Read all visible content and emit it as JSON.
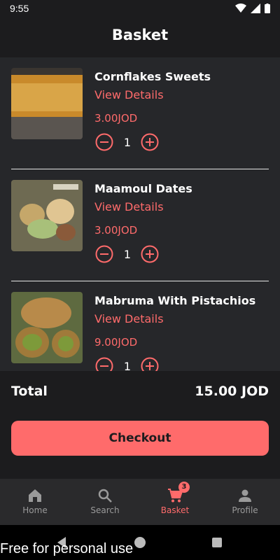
{
  "status": {
    "time": "9:55"
  },
  "header": {
    "title": "Basket"
  },
  "items": [
    {
      "name": "Cornflakes Sweets",
      "link": "View Details",
      "price": "3.00JOD",
      "qty": "1"
    },
    {
      "name": "Maamoul Dates",
      "link": "View Details",
      "price": "3.00JOD",
      "qty": "1"
    },
    {
      "name": "Mabruma With Pistachios",
      "link": "View Details",
      "price": "9.00JOD",
      "qty": "1"
    }
  ],
  "summary": {
    "total_label": "Total",
    "total_value": "15.00 JOD"
  },
  "checkout": {
    "label": "Checkout"
  },
  "nav": {
    "items": [
      {
        "label": "Home",
        "icon": "home-icon"
      },
      {
        "label": "Search",
        "icon": "search-icon"
      },
      {
        "label": "Basket",
        "icon": "cart-icon",
        "badge": "3"
      },
      {
        "label": "Profile",
        "icon": "profile-icon"
      }
    ]
  },
  "watermark": "Free for personal use",
  "colors": {
    "accent": "#ff6b6b",
    "background": "#1c1c1e",
    "list_bg": "#26272a"
  }
}
